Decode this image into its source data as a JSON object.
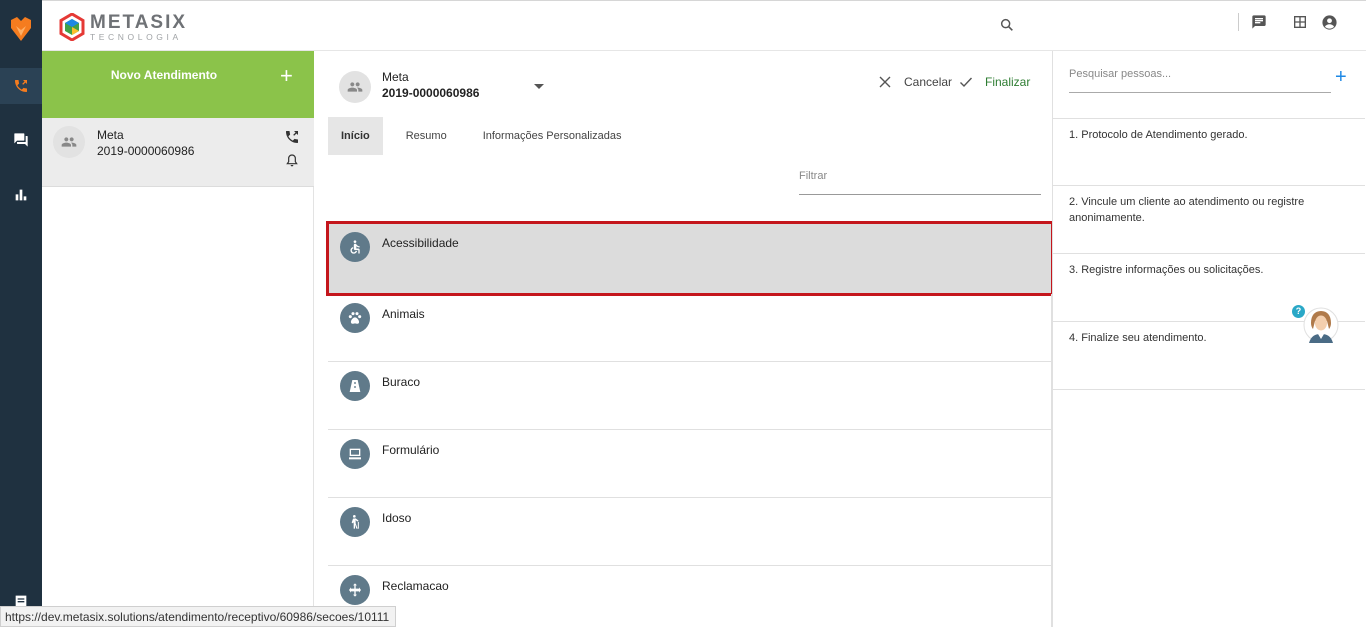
{
  "brand": {
    "name": "METASIX",
    "subtitle": "TECNOLOGIA"
  },
  "rail": {
    "items": [
      "phone-icon",
      "chat-icon",
      "bar-chart-icon"
    ],
    "accent": "#f57c1f"
  },
  "list": {
    "new_button_label": "Novo Atendimento",
    "add_symbol": "+",
    "call": {
      "name": "Meta",
      "protocol": "2019-0000060986"
    }
  },
  "main": {
    "header": {
      "name": "Meta",
      "protocol": "2019-0000060986"
    },
    "actions": {
      "cancel": "Cancelar",
      "finish": "Finalizar"
    },
    "tabs": [
      "Início",
      "Resumo",
      "Informações Personalizadas"
    ],
    "filter_placeholder": "Filtrar",
    "sections": [
      {
        "label": "Acessibilidade",
        "icon": "accessibility-icon"
      },
      {
        "label": "Animais",
        "icon": "paw-icon"
      },
      {
        "label": "Buraco",
        "icon": "road-icon"
      },
      {
        "label": "Formulário",
        "icon": "computer-icon"
      },
      {
        "label": "Idoso",
        "icon": "elderly-icon"
      },
      {
        "label": "Reclamacao",
        "icon": "move-icon"
      }
    ]
  },
  "right": {
    "search_placeholder": "Pesquisar pessoas...",
    "add_symbol": "+",
    "steps": [
      "1. Protocolo de Atendimento gerado.",
      "2. Vincule um cliente ao atendimento ou registre anonimamente.",
      "3. Registre informações ou solicitações.",
      "4. Finalize seu atendimento."
    ],
    "help_badge": "?"
  },
  "status_url": "https://dev.metasix.solutions/atendimento/receptivo/60986/secoes/10111",
  "colors": {
    "green": "#8bc34a",
    "rail": "#1f3140",
    "highlight_border": "#c4161c",
    "finish": "#2e7d32",
    "link_blue": "#1e88e5"
  }
}
